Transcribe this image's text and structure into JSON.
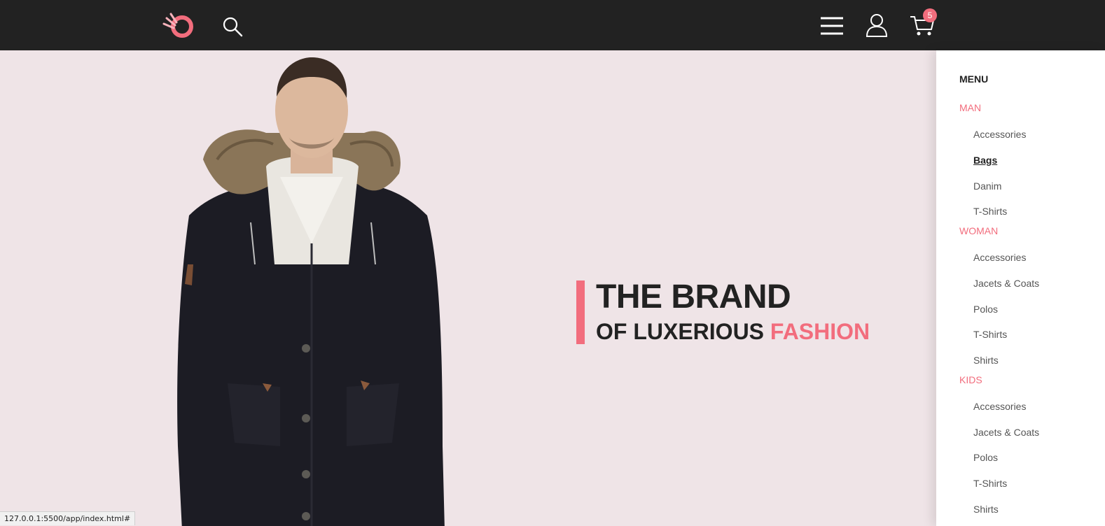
{
  "header": {
    "logo_icon": "brand-logo-icon",
    "search_icon": "search-icon",
    "menu_icon": "hamburger-icon",
    "user_icon": "user-icon",
    "cart_icon": "cart-icon",
    "cart_count": "5"
  },
  "hero": {
    "headline_line1": "THE BRAND",
    "headline_line2_prefix": "OF LUXERIOUS",
    "headline_line2_accent": "FASHION"
  },
  "menu": {
    "title": "MENU",
    "categories": [
      {
        "label": "MAN",
        "items": [
          "Accessories",
          "Bags",
          "Danim",
          "T-Shirts"
        ]
      },
      {
        "label": "WOMAN",
        "items": [
          "Accessories",
          "Jacets & Coats",
          "Polos",
          "T-Shirts",
          "Shirts"
        ]
      },
      {
        "label": "KIDS",
        "items": [
          "Accessories",
          "Jacets & Coats",
          "Polos",
          "T-Shirts",
          "Shirts"
        ]
      }
    ],
    "active_item": "Bags"
  },
  "status_bar": {
    "url": "127.0.0.1:5500/app/index.html#"
  },
  "colors": {
    "accent": "#f26d7d",
    "header_bg": "#222222",
    "hero_bg": "#efe4e7",
    "menu_bg": "#ffffff"
  }
}
